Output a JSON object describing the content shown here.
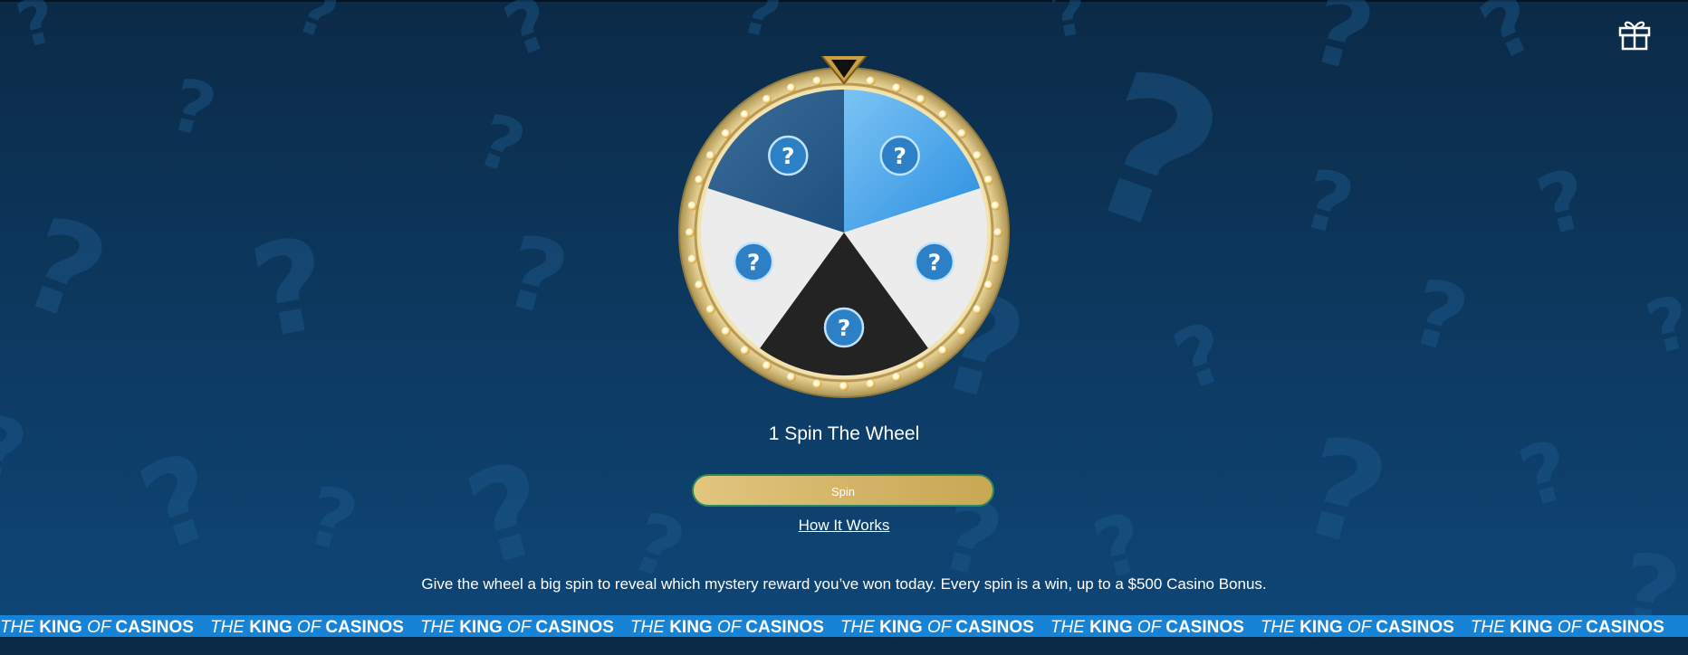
{
  "header": {
    "gift_icon": "gift-icon"
  },
  "wheel": {
    "segment_icon": "question-mark-icon",
    "segment_label": "?",
    "segments": [
      {
        "color": "#2b5f8f"
      },
      {
        "color": "#3a9be6"
      },
      {
        "color": "#ececec"
      },
      {
        "color": "#232323"
      },
      {
        "color": "#ececec"
      }
    ],
    "rim_color": "#d7bf80",
    "pointer_color": "#c9a042"
  },
  "title": "1 Spin The Wheel",
  "spin_button": "Spin",
  "how_it_works": "How It Works",
  "description": "Give the wheel a big spin to reveal which mystery reward you’ve won today. Every spin is a win, up to a $500 Casino Bonus.",
  "ticker": {
    "the": "THE",
    "king": "KING",
    "of": "OF",
    "casinos": "CASINOS"
  },
  "colors": {
    "background_top": "#0b2a47",
    "background_bottom": "#0e4677",
    "ticker_bg": "#1783d7",
    "spin_button_bg": "#d4b569"
  }
}
